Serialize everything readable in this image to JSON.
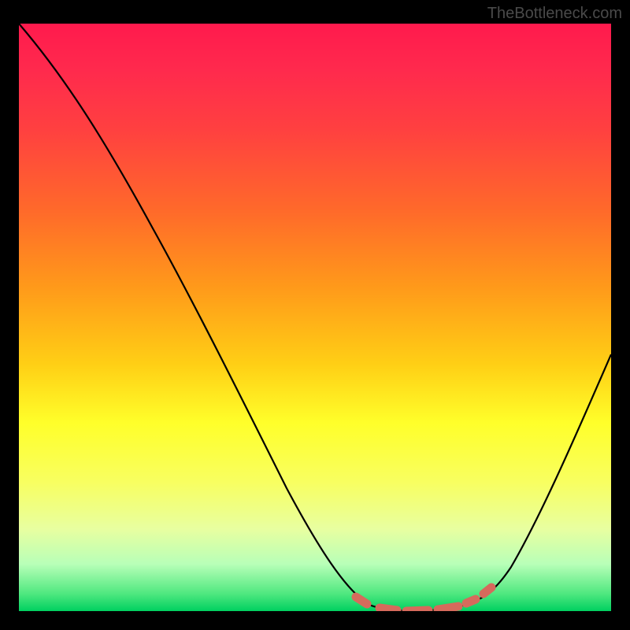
{
  "watermark": "TheBottleneck.com",
  "chart_data": {
    "type": "line",
    "title": "",
    "xlabel": "",
    "ylabel": "",
    "xlim": [
      0,
      100
    ],
    "ylim": [
      0,
      100
    ],
    "series": [
      {
        "name": "bottleneck-curve",
        "x": [
          0,
          6,
          12,
          18,
          24,
          30,
          36,
          42,
          48,
          54,
          58,
          62,
          66,
          70,
          74,
          78,
          82,
          86,
          90,
          94,
          100
        ],
        "values": [
          100,
          92,
          84,
          75,
          66,
          57,
          48,
          38,
          28,
          18,
          10,
          4,
          1,
          0,
          0,
          1,
          4,
          10,
          18,
          28,
          45
        ]
      }
    ],
    "flat_region": {
      "x_start": 58,
      "x_end": 78,
      "color": "#d66a5c"
    },
    "background_gradient": {
      "top": "#ff1a4d",
      "middle": "#ffff2a",
      "bottom": "#00d060"
    }
  }
}
